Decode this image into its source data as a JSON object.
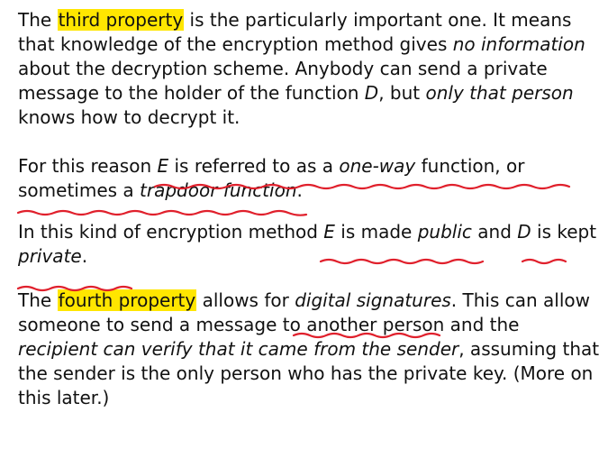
{
  "colors": {
    "text": "#111111",
    "highlight": "#ffe600",
    "ink": "#e0202c"
  },
  "p1": {
    "a": "The ",
    "b": "third property",
    "c": " is the particularly important one. It means that knowledge of the encryption method gives ",
    "d": "no information",
    "e": " about the decryption scheme. Anybody can send a private message to the holder of the function ",
    "f": "D",
    "g": ", but ",
    "h": "only that person",
    "i": " knows how to decrypt it."
  },
  "p2": {
    "a": "For this reason ",
    "b": "E",
    "c": " is referred to as a ",
    "d": "one-way",
    "e": " function, or sometimes a ",
    "f": "trapdoor function",
    "g": "."
  },
  "p3": {
    "a": "In this kind of encryption method ",
    "b": "E",
    "c": " is made ",
    "d": "public",
    "e": " and ",
    "f": "D",
    "g": " is kept ",
    "h": "private",
    "i": "."
  },
  "p4": {
    "a": "The ",
    "b": "fourth property",
    "c": " allows for ",
    "d": "digital signatures",
    "e": ". This can allow someone to send a message to another person and the ",
    "f": "recipient can verify that it came from the sender",
    "g": ", assuming that the sender is the only person who has the private key. (More on this later.)"
  }
}
